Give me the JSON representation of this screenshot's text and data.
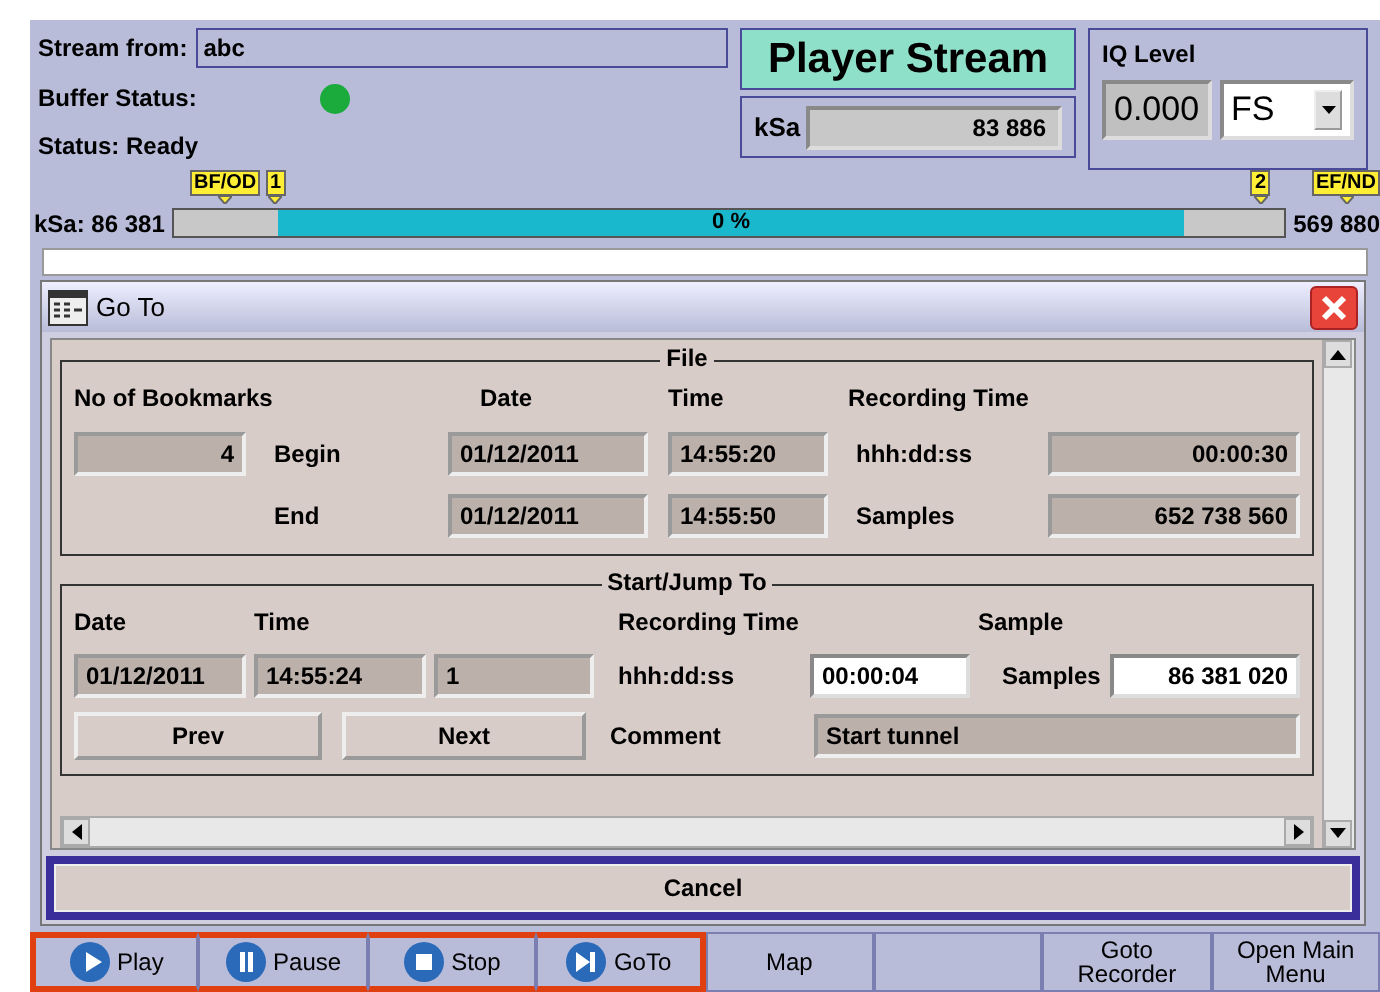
{
  "header": {
    "stream_from_label": "Stream from:",
    "stream_from": "abc",
    "buffer_status_label": "Buffer Status:",
    "buffer_ok": true,
    "status": "Status: Ready",
    "title": "Player Stream",
    "ksa_label": "kSa",
    "ksa_value": "83 886",
    "iq_title": "IQ Level",
    "iq_value": "0.000",
    "iq_unit": "FS"
  },
  "timeline": {
    "start": "kSa: 86 381",
    "end": "569 880",
    "percent": "0 %",
    "markers": [
      {
        "label": "BF/OD"
      },
      {
        "label": "1"
      },
      {
        "label": "2"
      },
      {
        "label": "EF/ND"
      }
    ]
  },
  "dialog": {
    "title": "Go To",
    "file": {
      "title": "File",
      "headers": [
        "No of Bookmarks",
        "Date",
        "Time",
        "Recording Time"
      ],
      "bookmarks": "4",
      "rows": [
        {
          "label": "Begin",
          "date": "01/12/2011",
          "time": "14:55:20",
          "unit": "hhh:dd:ss",
          "value": "00:00:30"
        },
        {
          "label": "End",
          "date": "01/12/2011",
          "time": "14:55:50",
          "unit": "Samples",
          "value": "652 738 560"
        }
      ]
    },
    "jump": {
      "title": "Start/Jump To",
      "headers": [
        "Date",
        "Time",
        "Recording Time",
        "Sample"
      ],
      "date": "01/12/2011",
      "time": "14:55:24",
      "index": "1",
      "rt_unit": "hhh:dd:ss",
      "rt_value": "00:00:04",
      "samples_label": "Samples",
      "samples_value": "86 381 020",
      "buttons": [
        "Prev",
        "Next"
      ],
      "comment_label": "Comment",
      "comment": "Start tunnel"
    },
    "cancel": "Cancel"
  },
  "softkeys": [
    {
      "kind": "play",
      "label": "Play",
      "highlighted": true
    },
    {
      "kind": "pause",
      "label": "Pause",
      "highlighted": true
    },
    {
      "kind": "stop",
      "label": "Stop",
      "highlighted": true
    },
    {
      "kind": "goto",
      "label": "GoTo",
      "highlighted": true
    },
    {
      "kind": "text",
      "label": "Map",
      "highlighted": false
    },
    {
      "kind": "blank",
      "highlighted": false
    },
    {
      "kind": "text",
      "label": "Goto Recorder",
      "highlighted": false
    },
    {
      "kind": "text",
      "label": "Open Main Menu",
      "highlighted": false
    }
  ]
}
